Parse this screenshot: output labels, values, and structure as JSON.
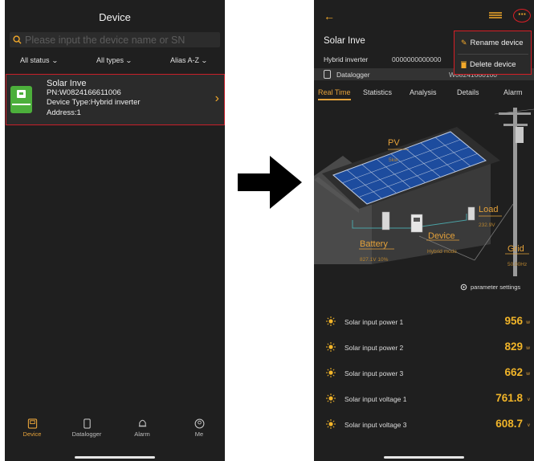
{
  "left": {
    "title": "Device",
    "search_placeholder": "Please input the device name or SN",
    "filters": {
      "status": "All status",
      "types": "All types",
      "sort": "Alias A-Z"
    },
    "device_card": {
      "name": "Solar Inve",
      "pn": "PN:W0824166611006",
      "type": "Device Type:Hybrid inverter",
      "address": "Address:1"
    },
    "tabs": [
      {
        "label": "Device",
        "icon": "device-icon"
      },
      {
        "label": "Datalogger",
        "icon": "datalogger-icon"
      },
      {
        "label": "Alarm",
        "icon": "bell-icon"
      },
      {
        "label": "Me",
        "icon": "user-icon"
      }
    ]
  },
  "right": {
    "device_name": "Solar Inve",
    "device_type": "Hybrid inverter",
    "device_sn": "0000000000000",
    "datalogger_label": "Datalogger",
    "datalogger_sn": "W08241660100",
    "menu": {
      "rename": "Rename device",
      "delete": "Delete device"
    },
    "tabs": [
      "Real Time",
      "Statistics",
      "Analysis",
      "Details",
      "Alarm"
    ],
    "scene": {
      "pv": "PV",
      "pv_sub": "5kw",
      "load": "Load",
      "load_sub": "232.9V",
      "battery": "Battery",
      "battery_sub": "827.1V  10%",
      "device": "Device",
      "device_sub": "Hybrid mode",
      "grid": "Grid",
      "grid_sub": "50.00Hz"
    },
    "params_label": "parameter settings",
    "metrics": [
      {
        "label": "Solar input power 1",
        "value": "956",
        "unit": "w"
      },
      {
        "label": "Solar input power 2",
        "value": "829",
        "unit": "w"
      },
      {
        "label": "Solar input power 3",
        "value": "662",
        "unit": "w"
      },
      {
        "label": "Solar input voltage 1",
        "value": "761.8",
        "unit": "v"
      },
      {
        "label": "Solar input voltage 3",
        "value": "608.7",
        "unit": "v"
      }
    ]
  },
  "colors": {
    "background": "#1f1f1f",
    "accent": "#e5a23a",
    "highlight": "#d61f26",
    "device_icon": "#4caf3b"
  }
}
